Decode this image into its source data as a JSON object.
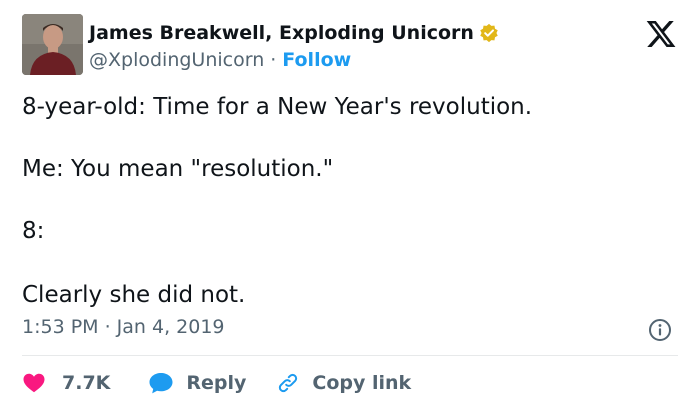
{
  "author": {
    "name": "James Breakwell, Exploding Unicorn",
    "handle": "@XplodingUnicorn",
    "separator": "·",
    "follow_label": "Follow",
    "verified_color": "#e2b719"
  },
  "platform_icon": "x-logo",
  "tweet": {
    "lines": [
      "8-year-old: Time for a New Year's revolution.",
      "Me: You mean \"resolution.\"",
      "8:",
      "Clearly she did not."
    ]
  },
  "timestamp": "1:53 PM · Jan 4, 2019",
  "actions": {
    "like_count": "7.7K",
    "reply_label": "Reply",
    "copy_label": "Copy link"
  },
  "colors": {
    "like": "#f91880",
    "reply": "#1d9bf0",
    "copy": "#1d9bf0",
    "text_secondary": "#536471",
    "link": "#1d9bf0"
  },
  "icons": [
    "verified-badge-icon",
    "x-logo-icon",
    "info-icon",
    "heart-icon",
    "reply-bubble-icon",
    "link-icon"
  ]
}
